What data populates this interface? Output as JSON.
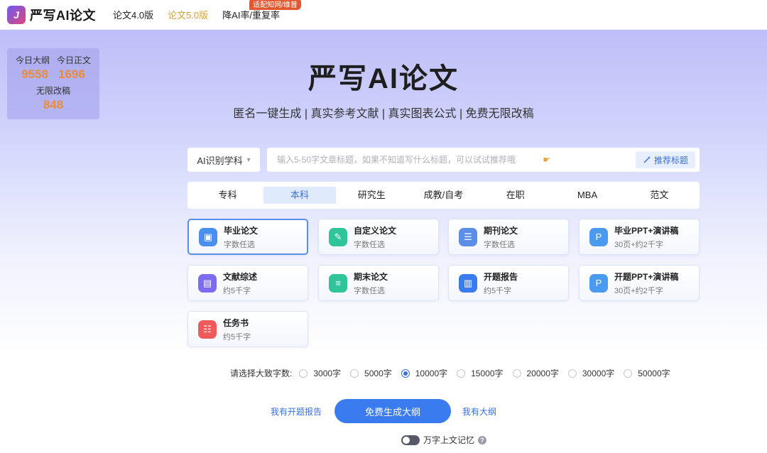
{
  "header": {
    "logo_text": "严写AI论文",
    "logo_glyph": "J",
    "nav": [
      {
        "label": "论文4.0版",
        "active": false
      },
      {
        "label": "论文5.0版",
        "active": true
      },
      {
        "label": "降AI率/重复率",
        "active": false,
        "badge": "适配知网/维普"
      }
    ]
  },
  "stats": {
    "outline_label": "今日大纲",
    "body_label": "今日正文",
    "outline_count": "9558",
    "body_count": "1696",
    "revise_label": "无限改稿",
    "revise_count": "848"
  },
  "hero": {
    "title": "严写AI论文",
    "subtitle": "匿名一键生成 | 真实参考文献 | 真实图表公式 | 免费无限改稿"
  },
  "search": {
    "subject_select": "AI识别学科",
    "placeholder": "输入5-50字文章标题，如果不知道写什么标题，可以试试推荐哦",
    "recommend_button": "推荐标题"
  },
  "levels": [
    {
      "label": "专科",
      "active": false
    },
    {
      "label": "本科",
      "active": true
    },
    {
      "label": "研究生",
      "active": false
    },
    {
      "label": "成教/自考",
      "active": false
    },
    {
      "label": "在职",
      "active": false
    },
    {
      "label": "MBA",
      "active": false
    },
    {
      "label": "范文",
      "active": false
    }
  ],
  "cards": [
    {
      "title": "毕业论文",
      "desc": "字数任选",
      "icon": "book-icon",
      "color": "#4a8ff0",
      "active": true
    },
    {
      "title": "自定义论文",
      "desc": "字数任选",
      "icon": "pen-icon",
      "color": "#2fc49a",
      "active": false
    },
    {
      "title": "期刊论文",
      "desc": "字数任选",
      "icon": "journal-icon",
      "color": "#5b8ee6",
      "active": false
    },
    {
      "title": "毕业PPT+演讲稿",
      "desc": "30页+约2千字",
      "icon": "ppt-icon",
      "color": "#4a9bf0",
      "active": false
    },
    {
      "title": "文献综述",
      "desc": "约5千字",
      "icon": "literature-icon",
      "color": "#7b6cf0",
      "active": false
    },
    {
      "title": "期末论文",
      "desc": "字数任选",
      "icon": "document-icon",
      "color": "#2fc49a",
      "active": false
    },
    {
      "title": "开题报告",
      "desc": "约5千字",
      "icon": "report-icon",
      "color": "#3b7bf0",
      "active": false
    },
    {
      "title": "开题PPT+演讲稿",
      "desc": "30页+约2千字",
      "icon": "ppt-icon",
      "color": "#4a9bf0",
      "active": false
    },
    {
      "title": "任务书",
      "desc": "约5千字",
      "icon": "task-icon",
      "color": "#f05a5a",
      "active": false
    }
  ],
  "word_count": {
    "label": "请选择大致字数:",
    "options": [
      {
        "label": "3000字",
        "selected": false
      },
      {
        "label": "5000字",
        "selected": false
      },
      {
        "label": "10000字",
        "selected": true
      },
      {
        "label": "15000字",
        "selected": false
      },
      {
        "label": "20000字",
        "selected": false
      },
      {
        "label": "30000字",
        "selected": false
      },
      {
        "label": "50000字",
        "selected": false
      }
    ]
  },
  "actions": {
    "left_link": "我有开题报告",
    "primary": "免费生成大纲",
    "right_link": "我有大纲"
  },
  "memory": {
    "label": "万字上文记忆",
    "enabled": false
  }
}
